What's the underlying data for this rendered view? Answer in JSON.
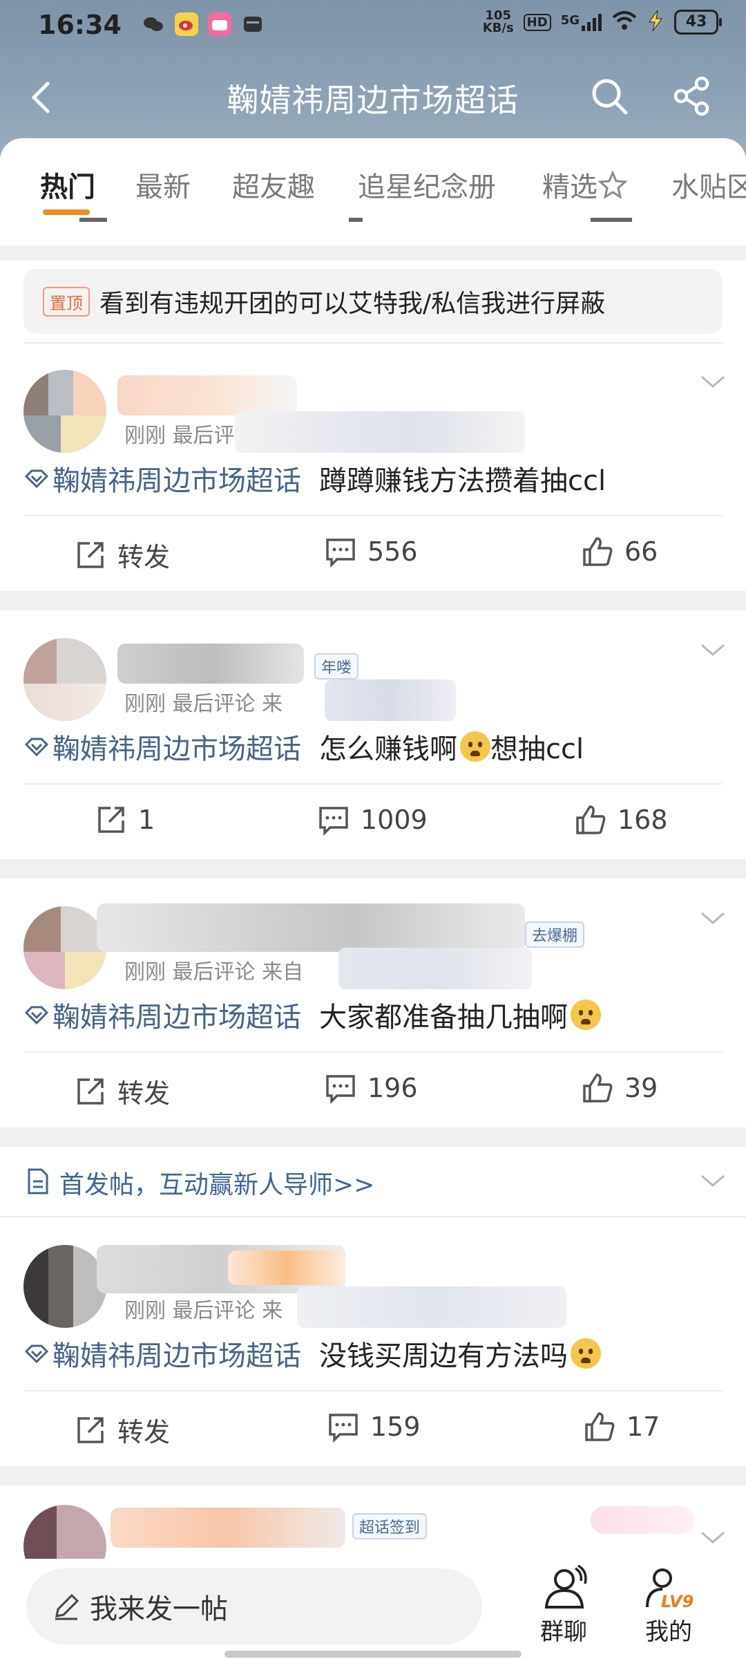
{
  "status_bar": {
    "time": "16:34",
    "net_speed_value": "105",
    "net_speed_unit": "KB/s",
    "hd_label": "HD",
    "signal_label": "5G",
    "battery": "43"
  },
  "header": {
    "title": "鞠婧祎周边市场超话"
  },
  "tabs": [
    {
      "label": "热门",
      "active": true
    },
    {
      "label": "最新"
    },
    {
      "label": "超友趣"
    },
    {
      "label": "追星纪念册"
    },
    {
      "label": "精选"
    },
    {
      "label": "水贴区"
    }
  ],
  "pinned": {
    "badge": "置顶",
    "text": "看到有违规开团的可以艾特我/私信我进行屏蔽"
  },
  "posts": [
    {
      "meta": "刚刚 最后评",
      "topic": "鞠婧祎周边市场超话",
      "text": "蹲蹲赚钱方法攒着抽ccl",
      "repost": "转发",
      "comments": "556",
      "likes": "66"
    },
    {
      "meta": "刚刚 最后评论 来",
      "badge": "年喽",
      "topic": "鞠婧祎周边市场超话",
      "text": "怎么赚钱啊",
      "text_after_emoji": "想抽ccl",
      "repost": "1",
      "comments": "1009",
      "likes": "168"
    },
    {
      "meta": "刚刚 最后评论 来自",
      "badge": "去爆棚",
      "topic": "鞠婧祎周边市场超话",
      "text": "大家都准备抽几抽啊",
      "repost": "转发",
      "comments": "196",
      "likes": "39"
    },
    {
      "meta": "刚刚 最后评论 来",
      "topic": "鞠婧祎周边市场超话",
      "text": "没钱买周边有方法吗",
      "repost": "转发",
      "comments": "159",
      "likes": "17"
    }
  ],
  "promo": {
    "text": "首发帖，互动赢新人导师>>"
  },
  "partial_post": {
    "badge": "超话签到"
  },
  "bottom_bar": {
    "compose_placeholder": "我来发一帖",
    "group_chat": "群聊",
    "mine": "我的",
    "level": "LV9"
  },
  "colors": {
    "accent": "#f28b22",
    "topic": "#46638c",
    "header_bg": "#8a9db1"
  }
}
